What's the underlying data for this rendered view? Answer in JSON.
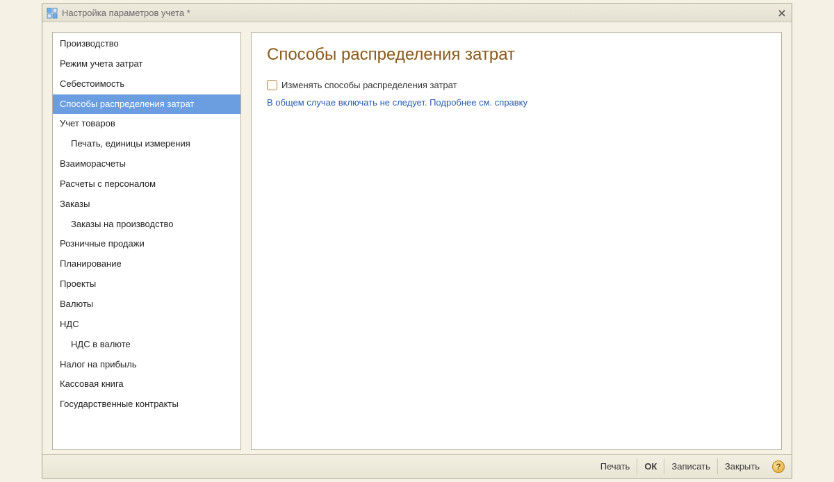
{
  "window": {
    "title": "Настройка параметров учета *"
  },
  "sidebar": {
    "items": [
      {
        "label": "Производство",
        "indent": false,
        "selected": false
      },
      {
        "label": "Режим учета затрат",
        "indent": false,
        "selected": false
      },
      {
        "label": "Себестоимость",
        "indent": false,
        "selected": false
      },
      {
        "label": "Способы распределения затрат",
        "indent": false,
        "selected": true
      },
      {
        "label": "Учет товаров",
        "indent": false,
        "selected": false
      },
      {
        "label": "Печать, единицы измерения",
        "indent": true,
        "selected": false
      },
      {
        "label": "Взаиморасчеты",
        "indent": false,
        "selected": false
      },
      {
        "label": "Расчеты с персоналом",
        "indent": false,
        "selected": false
      },
      {
        "label": "Заказы",
        "indent": false,
        "selected": false
      },
      {
        "label": "Заказы на производство",
        "indent": true,
        "selected": false
      },
      {
        "label": "Розничные продажи",
        "indent": false,
        "selected": false
      },
      {
        "label": "Планирование",
        "indent": false,
        "selected": false
      },
      {
        "label": "Проекты",
        "indent": false,
        "selected": false
      },
      {
        "label": "Валюты",
        "indent": false,
        "selected": false
      },
      {
        "label": "НДС",
        "indent": false,
        "selected": false
      },
      {
        "label": "НДС в валюте",
        "indent": true,
        "selected": false
      },
      {
        "label": "Налог на прибыль",
        "indent": false,
        "selected": false
      },
      {
        "label": "Кассовая книга",
        "indent": false,
        "selected": false
      },
      {
        "label": "Государственные контракты",
        "indent": false,
        "selected": false
      }
    ]
  },
  "content": {
    "title": "Способы распределения затрат",
    "checkbox_label": "Изменять способы распределения затрат",
    "checkbox_checked": false,
    "hint": "В общем случае включать не следует. Подробнее см. справку"
  },
  "footer": {
    "print": "Печать",
    "ok": "ОК",
    "save": "Записать",
    "close": "Закрыть",
    "help": "?"
  }
}
